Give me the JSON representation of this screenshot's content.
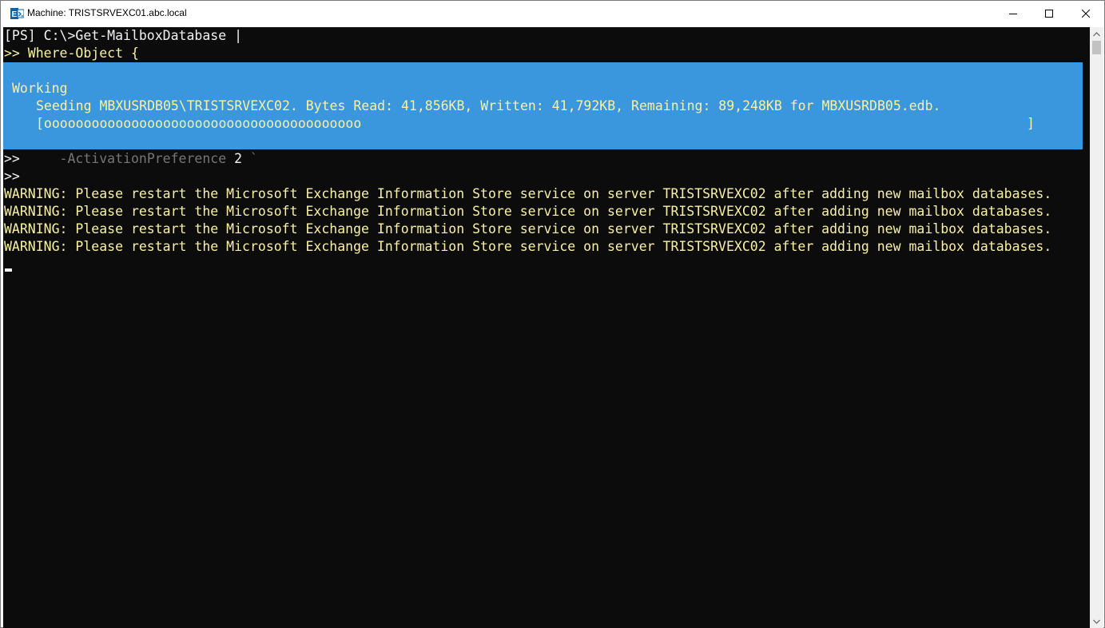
{
  "window": {
    "title": "Machine: TRISTSRVEXC01.abc.local",
    "icon": "exchange-management-shell-icon"
  },
  "console": {
    "prompt_line": "[PS] C:\\>Get-MailboxDatabase |",
    "continuation_line": ">> Where-Object {",
    "progress": {
      "heading": "Working",
      "status": "Seeding MBXUSRDB05\\TRISTSRVEXC02. Bytes Read: 41,856KB, Written: 41,792KB, Remaining: 89,248KB for MBXUSRDB05.edb.",
      "bar_fill": "[oooooooooooooooooooooooooooooooooooooooo",
      "bar_end": "]",
      "percent_complete": 32
    },
    "param_line": {
      "prefix": ">>",
      "param": "-ActivationPreference",
      "value": "2",
      "tick": "`"
    },
    "empty_continuation": ">>",
    "warnings": [
      "WARNING: Please restart the Microsoft Exchange Information Store service on server TRISTSRVEXC02 after adding new mailbox databases.",
      "WARNING: Please restart the Microsoft Exchange Information Store service on server TRISTSRVEXC02 after adding new mailbox databases.",
      "WARNING: Please restart the Microsoft Exchange Information Store service on server TRISTSRVEXC02 after adding new mailbox databases.",
      "WARNING: Please restart the Microsoft Exchange Information Store service on server TRISTSRVEXC02 after adding new mailbox databases."
    ]
  },
  "colors": {
    "console_bg": "#0c0c0c",
    "progress_bg": "#3a96dd",
    "text_yellow": "#f9f1a5",
    "text_gray": "#767676"
  }
}
